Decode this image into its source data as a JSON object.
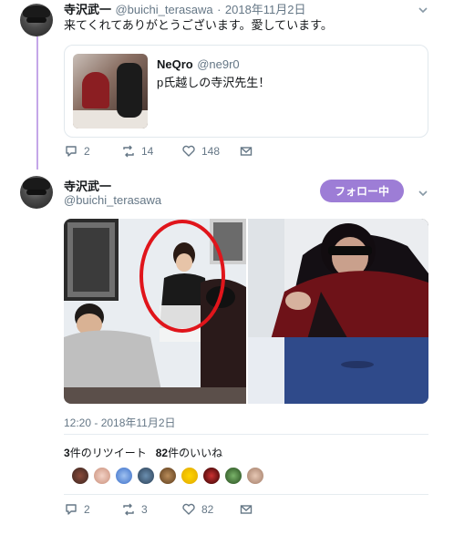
{
  "tweet1": {
    "name": "寺沢武一",
    "handle": "@buichi_terasawa",
    "separator": "·",
    "date": "2018年11月2日",
    "text": "来てくれてありがとうございます。愛しています。",
    "quote": {
      "name": "NeQro",
      "handle": "@ne9r0",
      "text": "p氏越しの寺沢先生！"
    },
    "actions": {
      "replies": "2",
      "retweets": "14",
      "likes": "148"
    }
  },
  "tweet2": {
    "name": "寺沢武一",
    "handle": "@buichi_terasawa",
    "follow_label": "フォロー中",
    "timestamp": "12:20 - 2018年11月2日",
    "retweet_count": "3",
    "retweet_label": "件のリツイート",
    "like_count": "82",
    "like_label": "件のいいね",
    "actions": {
      "replies": "2",
      "retweets": "3",
      "likes": "82"
    }
  },
  "colors": {
    "accent": "#9d7dd6",
    "thread_line": "#c4a7e8",
    "muted": "#657786",
    "annotation_circle": "#e0151b"
  },
  "icons": [
    "reply-icon",
    "retweet-icon",
    "like-icon",
    "message-icon",
    "chevron-down-icon"
  ]
}
